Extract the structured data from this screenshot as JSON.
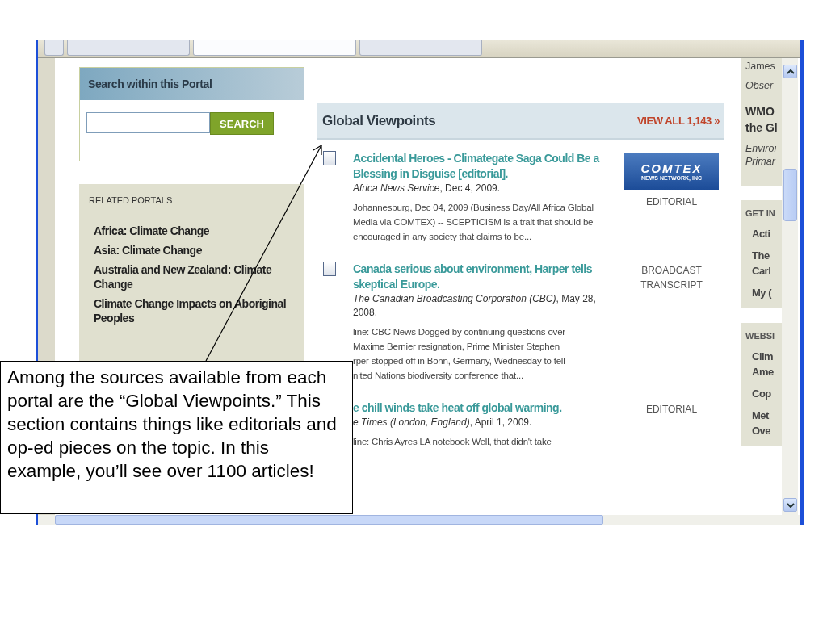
{
  "browser_tabs": [
    {
      "selected": false
    },
    {
      "selected": false
    },
    {
      "selected": true
    },
    {
      "selected": false
    }
  ],
  "search_panel": {
    "title": "Search within this Portal",
    "button": "SEARCH"
  },
  "related_portals": {
    "heading": "RELATED PORTALS",
    "items": [
      {
        "label": "Africa: Climate Change"
      },
      {
        "label": "Asia: Climate Change"
      },
      {
        "label": "Australia and New Zealand: Climate Change"
      },
      {
        "label": "Climate Change Impacts on Aboriginal Peoples"
      }
    ]
  },
  "global_viewpoints": {
    "title": "Global Viewpoints",
    "view_all": "VIEW ALL 1,143 »",
    "items": [
      {
        "checked": false,
        "title": "Accidental Heroes - Climategate Saga Could Be a Blessing in Disguise [editorial].",
        "source": "*Africa News Service*, Dec 4, 2009.",
        "snippet": [
          "Johannesburg, Dec 04, 2009 (Business Day/All Africa Global Media via COMTEX) -- SCEPTICISM is a trait that should be encouraged in any society that claims to be..."
        ],
        "logo": {
          "name": "COMTEX",
          "tagline": "NEWS NETWORK, INC"
        },
        "type": "EDITORIAL"
      },
      {
        "checked": false,
        "title": "Canada serious about environment, Harper tells skeptical Europe.",
        "source": "*The Canadian Broadcasting Corporation (CBC)*, May 28, 2008.",
        "snippet": [
          "line: CBC News Dogged by continuing questions over",
          "Maxime Bernier resignation, Prime Minister Stephen",
          "rper stopped off in Bonn, Germany, Wednesday to tell",
          "nited Nations biodiversity conference that..."
        ],
        "type": "BROADCAST TRANSCRIPT"
      },
      {
        "title": "e chill winds take heat off global warming.",
        "source": "*e Times (London, England)*, April 1, 2009.",
        "snippet": [
          "line: Chris Ayres LA notebook Well, that didn't take"
        ],
        "type": "EDITORIAL"
      }
    ]
  },
  "right_column": [
    {
      "lines": [
        {
          "kind": "plain",
          "lines": [
            "James"
          ]
        },
        {
          "kind": "italic",
          "lines": [
            "Obser"
          ]
        },
        {
          "kind": "title",
          "lines": [
            "WMO",
            "the Gl"
          ]
        },
        {
          "kind": "italic",
          "lines": [
            "Enviroi",
            "Primar"
          ]
        }
      ]
    },
    {
      "heading": "GET IN",
      "lines": [
        {
          "kind": "link",
          "lines": [
            "Acti"
          ]
        },
        {
          "kind": "link",
          "lines": [
            "The",
            "Carl"
          ]
        },
        {
          "kind": "link",
          "lines": [
            "My ("
          ]
        }
      ]
    },
    {
      "heading": "WEBSI",
      "lines": [
        {
          "kind": "link",
          "lines": [
            "Clim",
            "Ame"
          ]
        },
        {
          "kind": "link",
          "lines": [
            "Cop"
          ]
        },
        {
          "kind": "link",
          "lines": [
            "Met",
            "Ove"
          ]
        }
      ]
    }
  ],
  "callout": {
    "text": "Among the sources available from each portal are the “Global Viewpoints.” This section contains things like editorials and op-ed pieces on the topic. In this example, you’ll see over 1100 articles!"
  }
}
